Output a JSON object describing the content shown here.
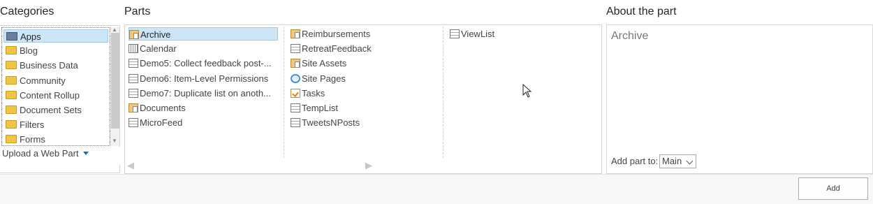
{
  "headers": {
    "categories": "Categories",
    "parts": "Parts",
    "about": "About the part"
  },
  "categories": {
    "items": [
      {
        "label": "Apps",
        "icon": "apps-icon",
        "selected": true
      },
      {
        "label": "Blog",
        "icon": "folder-icon"
      },
      {
        "label": "Business Data",
        "icon": "folder-icon"
      },
      {
        "label": "Community",
        "icon": "folder-icon"
      },
      {
        "label": "Content Rollup",
        "icon": "folder-icon"
      },
      {
        "label": "Document Sets",
        "icon": "folder-icon"
      },
      {
        "label": "Filters",
        "icon": "folder-icon"
      },
      {
        "label": "Forms",
        "icon": "folder-icon"
      }
    ],
    "upload_label": "Upload a Web Part"
  },
  "parts": {
    "col1": [
      {
        "label": "Archive",
        "icon": "document-library-icon",
        "selected": true
      },
      {
        "label": "Calendar",
        "icon": "calendar-icon"
      },
      {
        "label": "Demo5: Collect feedback post-...",
        "icon": "list-icon"
      },
      {
        "label": "Demo6: Item-Level Permissions",
        "icon": "list-icon"
      },
      {
        "label": "Demo7: Duplicate list on anoth...",
        "icon": "list-icon"
      },
      {
        "label": "Documents",
        "icon": "document-library-icon"
      },
      {
        "label": "MicroFeed",
        "icon": "list-icon"
      }
    ],
    "col2": [
      {
        "label": "Reimbursements",
        "icon": "document-library-icon"
      },
      {
        "label": "RetreatFeedback",
        "icon": "list-icon"
      },
      {
        "label": "Site Assets",
        "icon": "document-library-icon"
      },
      {
        "label": "Site Pages",
        "icon": "site-pages-icon"
      },
      {
        "label": "Tasks",
        "icon": "tasks-icon"
      },
      {
        "label": "TempList",
        "icon": "list-icon"
      },
      {
        "label": "TweetsNPosts",
        "icon": "list-icon"
      }
    ],
    "col3": [
      {
        "label": "ViewList",
        "icon": "list-icon"
      }
    ]
  },
  "about": {
    "title": "Archive",
    "add_to_label": "Add part to:",
    "zone_value": "Main"
  },
  "footer": {
    "add_label": "Add"
  },
  "colors": {
    "selection": "#cde6f7",
    "accent": "#0072c6"
  }
}
